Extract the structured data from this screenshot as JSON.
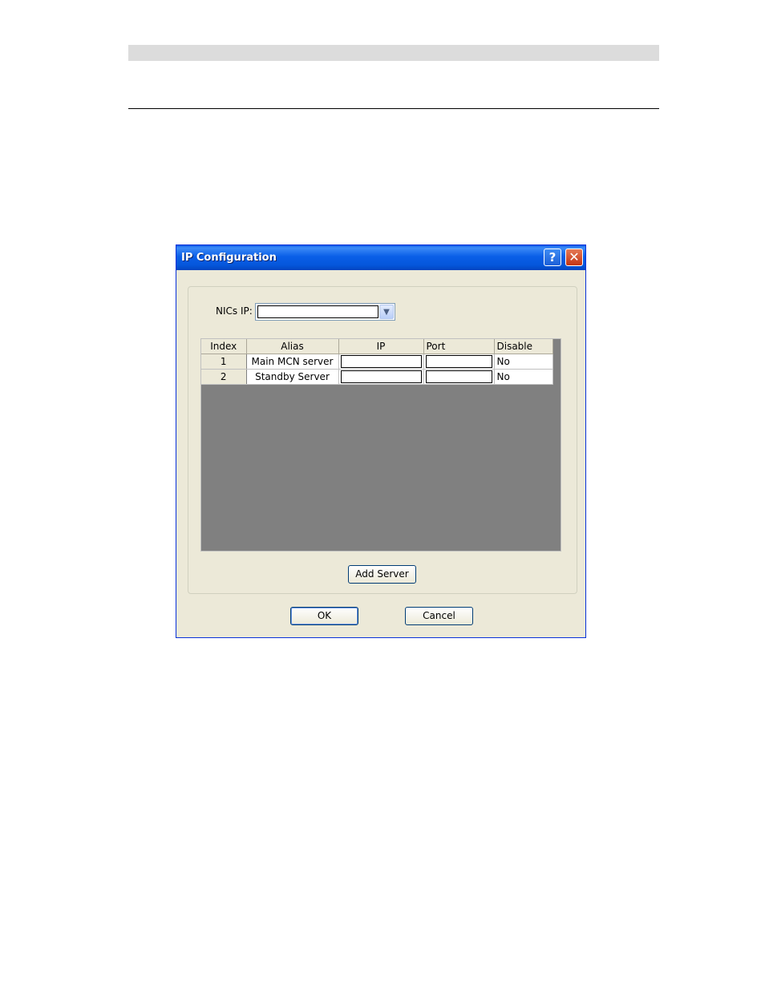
{
  "window": {
    "title": "IP Configuration"
  },
  "titlebar": {
    "help_glyph": "?",
    "close_glyph": "✕"
  },
  "nics": {
    "label": "NICs IP:",
    "value": ""
  },
  "grid": {
    "headers": [
      "Index",
      "Alias",
      "IP",
      "Port",
      "Disable"
    ],
    "rows": [
      {
        "index": "1",
        "alias": "Main MCN server",
        "ip": "",
        "port": "",
        "disable": "No"
      },
      {
        "index": "2",
        "alias": "Standby Server",
        "ip": "",
        "port": "",
        "disable": "No"
      }
    ]
  },
  "buttons": {
    "add_server": "Add Server",
    "ok": "OK",
    "cancel": "Cancel"
  },
  "colors": {
    "titlebar": "#0a5fe8",
    "dialog_bg": "#ece9d8",
    "grid_bg": "#808080"
  }
}
